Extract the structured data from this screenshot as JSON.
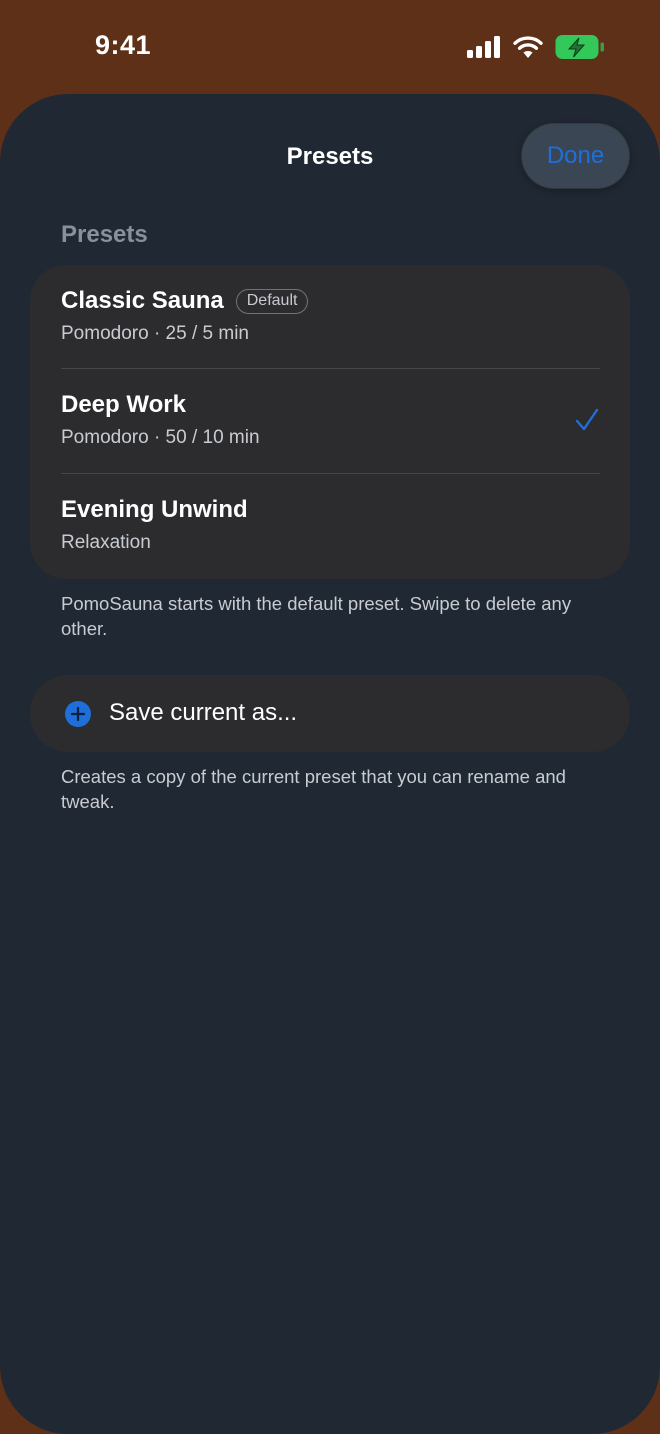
{
  "status_bar": {
    "time": "9:41",
    "icons": [
      "cellular-signal-icon",
      "wifi-icon",
      "battery-charging-icon"
    ],
    "battery_color": "#34c759"
  },
  "sheet": {
    "title": "Presets",
    "done_label": "Done",
    "accent_color": "#1e6fd9"
  },
  "section": {
    "header": "Presets",
    "items": [
      {
        "name": "Classic Sauna",
        "badge": "Default",
        "subtitle": "Pomodoro · 25 / 5 min",
        "selected": false
      },
      {
        "name": "Deep Work",
        "badge": "",
        "subtitle": "Pomodoro · 50 / 10 min",
        "selected": true
      },
      {
        "name": "Evening Unwind",
        "badge": "",
        "subtitle": "Relaxation",
        "selected": false
      }
    ],
    "footer": "PomoSauna starts with the default preset. Swipe to delete any other."
  },
  "save": {
    "icon": "plus-circle-icon",
    "label": "Save current as...",
    "footer": "Creates a copy of the current preset that you can rename and tweak."
  }
}
